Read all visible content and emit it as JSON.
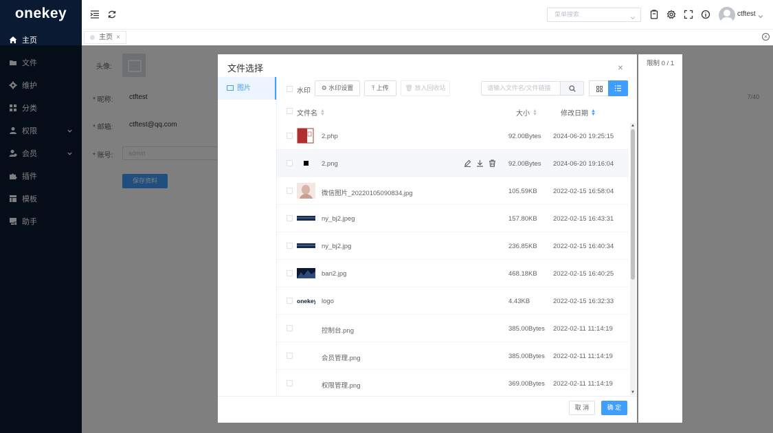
{
  "logo": "onekey",
  "sidebar": {
    "items": [
      {
        "label": "主页",
        "icon": "home-icon"
      },
      {
        "label": "文件",
        "icon": "folder-icon"
      },
      {
        "label": "维护",
        "icon": "gear-icon"
      },
      {
        "label": "分类",
        "icon": "grid-icon"
      },
      {
        "label": "权限",
        "icon": "user-icon",
        "expandable": true
      },
      {
        "label": "会员",
        "icon": "members-icon",
        "expandable": true
      },
      {
        "label": "插件",
        "icon": "puzzle-icon"
      },
      {
        "label": "模板",
        "icon": "template-icon"
      },
      {
        "label": "助手",
        "icon": "assistant-icon"
      }
    ]
  },
  "header": {
    "menu_search_placeholder": "菜单搜索",
    "username": "ctftest"
  },
  "tabs": [
    {
      "label": "主页",
      "close": "×"
    }
  ],
  "background_form": {
    "avatar_label": "头像:",
    "nickname_label": "* 昵称:",
    "nickname_value": "ctftest",
    "nickname_counter": "7/40",
    "email_label": "* 邮箱:",
    "email_value": "ctftest@qq.com",
    "account_label": "* 账号:",
    "account_placeholder": "admin",
    "save_label": "保存资料"
  },
  "dialog": {
    "title": "文件选择",
    "close": "×",
    "side_item": "图片",
    "watermark_label": "水印",
    "watermark_settings": "水印设置",
    "upload": "上传",
    "recycle": "放入回收站",
    "search_placeholder": "请输入文件名/文件链接",
    "col_name": "文件名",
    "col_size": "大小",
    "col_date": "修改日期",
    "cancel": "取 消",
    "ok": "确 定",
    "files": [
      {
        "name": "2.php",
        "size": "92.00Bytes",
        "date": "2024-06-20 19:25:15",
        "thumb": "red-doc"
      },
      {
        "name": "2.png",
        "size": "92.00Bytes",
        "date": "2024-06-20 19:16:04",
        "thumb": "black-square"
      },
      {
        "name": "微信图片_20220105090834.jpg",
        "size": "105.59KB",
        "date": "2022-02-15 16:58:04",
        "thumb": "photo"
      },
      {
        "name": "ny_bj2.jpeg",
        "size": "157.80KB",
        "date": "2022-02-15 16:43:31",
        "thumb": "dark-banner"
      },
      {
        "name": "ny_bj2.jpg",
        "size": "236.85KB",
        "date": "2022-02-15 16:40:34",
        "thumb": "dark-banner"
      },
      {
        "name": "ban2.jpg",
        "size": "468.18KB",
        "date": "2022-02-15 16:40:25",
        "thumb": "dark-photo"
      },
      {
        "name": "logo",
        "size": "4.43KB",
        "date": "2022-02-15 16:32:33",
        "thumb": "logo"
      },
      {
        "name": "控制台.png",
        "size": "385.00Bytes",
        "date": "2022-02-11 11:14:19",
        "thumb": "none"
      },
      {
        "name": "会员管理.png",
        "size": "385.00Bytes",
        "date": "2022-02-11 11:14:19",
        "thumb": "none"
      },
      {
        "name": "权限管理.png",
        "size": "369.00Bytes",
        "date": "2022-02-11 11:14:19",
        "thumb": "none"
      }
    ]
  },
  "selection": {
    "label": "限制 0 / 1"
  },
  "colors": {
    "sidebar": "#0a1a33",
    "accent": "#409eff"
  }
}
